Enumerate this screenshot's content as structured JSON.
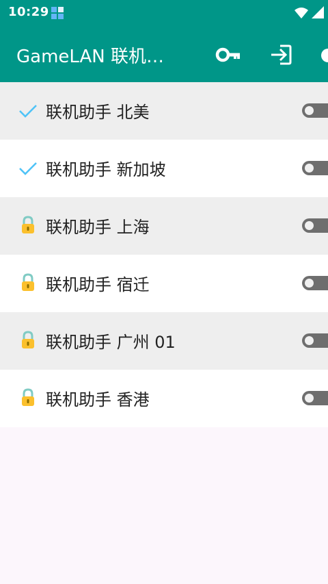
{
  "status_bar": {
    "time": "10:29"
  },
  "app_bar": {
    "title": "GameLAN 联机…",
    "actions": [
      "key-icon",
      "login-icon",
      "more-icon"
    ]
  },
  "servers": [
    {
      "name": "联机助手 北美",
      "status_icon": "check-icon",
      "enabled": false
    },
    {
      "name": "联机助手 新加坡",
      "status_icon": "check-icon",
      "enabled": false
    },
    {
      "name": "联机助手 上海",
      "status_icon": "lock-icon",
      "enabled": false
    },
    {
      "name": "联机助手 宿迁",
      "status_icon": "lock-icon",
      "enabled": false
    },
    {
      "name": "联机助手 广州 01",
      "status_icon": "lock-icon",
      "enabled": false
    },
    {
      "name": "联机助手 香港",
      "status_icon": "lock-icon",
      "enabled": false
    }
  ],
  "colors": {
    "primary": "#009688",
    "row_shaded": "#eeeeee",
    "row_plain": "#ffffff",
    "check": "#4fc3f7",
    "lock": "#fbc02d",
    "toggle_off_track": "#6e6e6e"
  }
}
